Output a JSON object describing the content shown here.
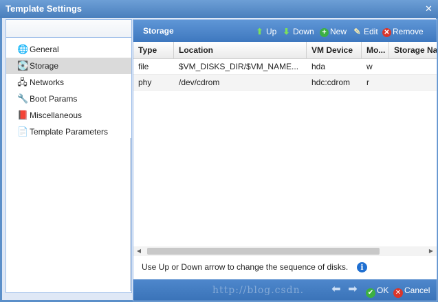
{
  "window": {
    "title": "Template Settings",
    "close_label": "✕"
  },
  "nav": {
    "items": [
      {
        "label": "General",
        "icon": "globe-icon",
        "glyph": "🌐"
      },
      {
        "label": "Storage",
        "icon": "disk-icon",
        "glyph": "💽"
      },
      {
        "label": "Networks",
        "icon": "network-icon",
        "glyph": "🖧"
      },
      {
        "label": "Boot Params",
        "icon": "wrench-icon",
        "glyph": "🔧"
      },
      {
        "label": "Miscellaneous",
        "icon": "misc-icon",
        "glyph": "📕"
      },
      {
        "label": "Template Parameters",
        "icon": "document-icon",
        "glyph": "📄"
      }
    ],
    "selected": "Storage"
  },
  "panel": {
    "title": "Storage",
    "toolbar": {
      "up": "Up",
      "down": "Down",
      "new": "New",
      "edit": "Edit",
      "remove": "Remove"
    },
    "columns": [
      "Type",
      "Location",
      "VM Device",
      "Mo...",
      "Storage Na"
    ],
    "rows": [
      {
        "type": "file",
        "location": "$VM_DISKS_DIR/$VM_NAME...",
        "device": "hda",
        "mode": "w",
        "storage": ""
      },
      {
        "type": "phy",
        "location": "/dev/cdrom",
        "device": "hdc:cdrom",
        "mode": "r",
        "storage": ""
      }
    ],
    "hint": "Use Up or Down arrow to change the sequence of disks.",
    "footer": {
      "ok": "OK",
      "cancel": "Cancel",
      "watermark": "http://blog.csdn."
    }
  },
  "colors": {
    "accent": "#3e78bf",
    "selected_row": "#dadada"
  }
}
